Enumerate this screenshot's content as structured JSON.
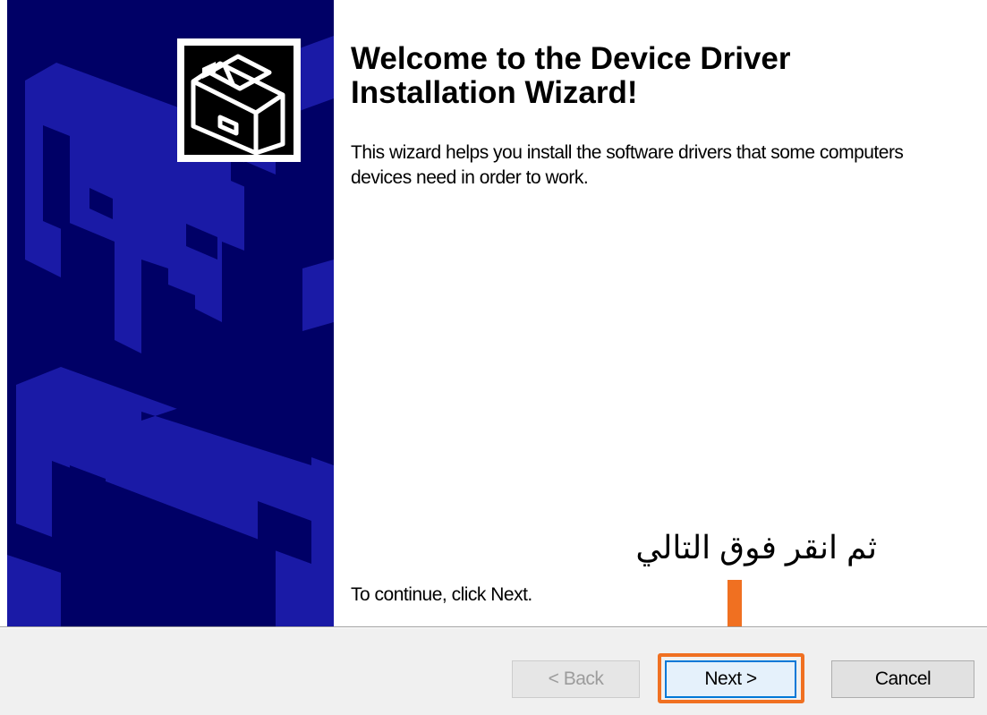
{
  "wizard": {
    "title": "Welcome to the Device Driver Installation Wizard!",
    "description": "This wizard helps you install the software drivers that some computers devices need in order to work.",
    "continue_text": "To continue, click Next."
  },
  "annotation": {
    "text": "ثم انقر فوق التالي",
    "color": "#f07021"
  },
  "buttons": {
    "back_label": "< Back",
    "next_label": "Next >",
    "cancel_label": "Cancel"
  },
  "colors": {
    "banner": "#000066",
    "banner_pattern": "#1a1aa6",
    "highlight": "#f07021",
    "footer": "#f0f0f0"
  },
  "icons": {
    "banner_art": "device-hardware-art",
    "logo": "driver-card-icon",
    "arrow": "down-arrow-icon"
  }
}
